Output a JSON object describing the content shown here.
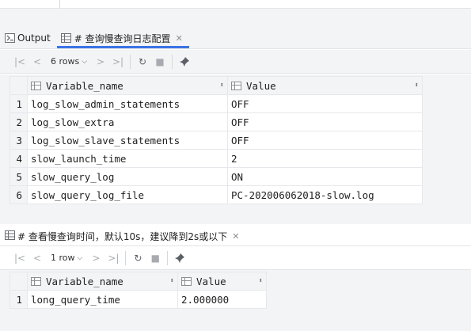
{
  "tab_output_label": "Output",
  "tab_query1_label": "# 查询慢查询日志配置",
  "tab_query2_label": "# 查看慢查询时间，默认10s，建议降到2s或以下",
  "result1": {
    "rows_label": "6 rows",
    "columns": [
      "Variable_name",
      "Value"
    ],
    "rows": [
      {
        "n": "1",
        "name": "log_slow_admin_statements",
        "value": "OFF"
      },
      {
        "n": "2",
        "name": "log_slow_extra",
        "value": "OFF"
      },
      {
        "n": "3",
        "name": "log_slow_slave_statements",
        "value": "OFF"
      },
      {
        "n": "4",
        "name": "slow_launch_time",
        "value": "2"
      },
      {
        "n": "5",
        "name": "slow_query_log",
        "value": "ON"
      },
      {
        "n": "6",
        "name": "slow_query_log_file",
        "value": "PC-202006062018-slow.log"
      }
    ]
  },
  "result2": {
    "rows_label": "1 row",
    "columns": [
      "Variable_name",
      "Value"
    ],
    "rows": [
      {
        "n": "1",
        "name": "long_query_time",
        "value": "2.000000"
      }
    ]
  },
  "icons": {
    "first": "first-page-icon",
    "prev": "prev-page-icon",
    "next": "next-page-icon",
    "last": "last-page-icon",
    "refresh": "refresh-icon",
    "stop": "stop-icon",
    "pin": "pin-icon"
  },
  "colors": {
    "accent": "#3b74e6",
    "panel": "#f3f4f6"
  }
}
